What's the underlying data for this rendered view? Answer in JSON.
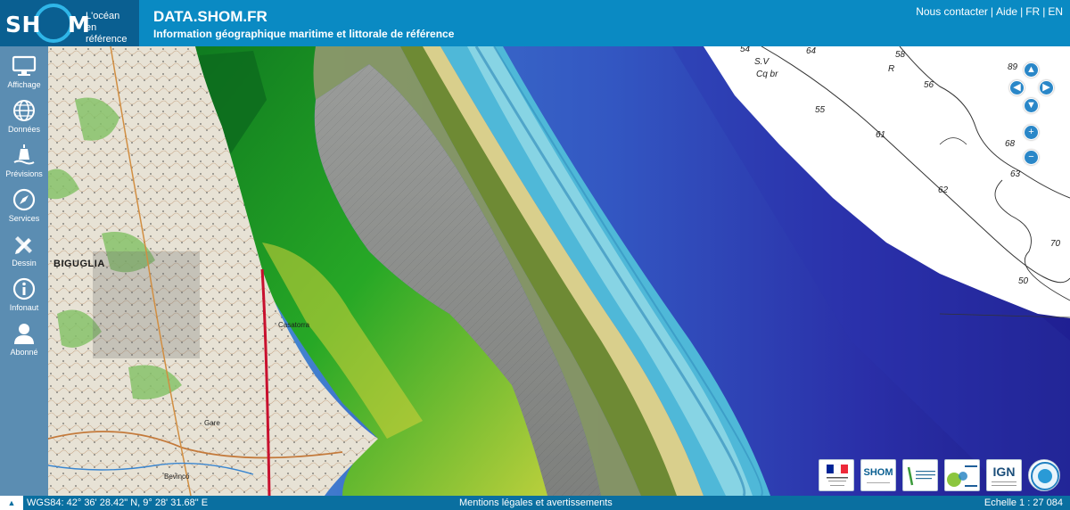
{
  "header": {
    "logo_word_left": "SH",
    "logo_word_right": "M",
    "logo_tagline_1": "L'océan",
    "logo_tagline_2": "en référence",
    "title": "DATA.SHOM.FR",
    "subtitle": "Information géographique maritime et littorale de référence",
    "links": [
      "Nous contacter",
      "Aide",
      "FR",
      "EN"
    ],
    "separator": "|"
  },
  "sidebar": {
    "items": [
      {
        "label": "Affichage",
        "icon": "monitor-icon"
      },
      {
        "label": "Données",
        "icon": "globe-icon"
      },
      {
        "label": "Prévisions",
        "icon": "buoy-icon"
      },
      {
        "label": "Services",
        "icon": "compass-icon"
      },
      {
        "label": "Dessin",
        "icon": "pencil-ruler-icon"
      },
      {
        "label": "Infonaut",
        "icon": "info-icon"
      },
      {
        "label": "Abonné",
        "icon": "user-icon"
      }
    ]
  },
  "map": {
    "town": "BIGUGLIA",
    "places": [
      "Casatorra",
      "Bevinco",
      "Gare"
    ],
    "depth_soundings": [
      "54",
      "64",
      "S.V",
      "Cq br",
      "58",
      "56",
      "89",
      "55",
      "61",
      "68",
      "63",
      "62",
      "70",
      "50",
      "R"
    ],
    "nav": {
      "up": "▲",
      "down": "▼",
      "left": "◀",
      "right": "▶",
      "zoom_in": "+",
      "zoom_out": "−"
    },
    "partners": [
      {
        "name": "Préfet de Corse",
        "icon": "marianne-logo"
      },
      {
        "name": "SHOM",
        "icon": "shom-logo"
      },
      {
        "name": "Collectivité de Corse",
        "icon": "collectivite-corse-logo"
      },
      {
        "name": "L'Europe s'engage en Corse",
        "icon": "europe-logo"
      },
      {
        "name": "IGN",
        "icon": "ign-logo"
      },
      {
        "name": "GEBCO",
        "icon": "gebco-logo"
      }
    ]
  },
  "footer": {
    "toggle": "▲",
    "coords": "WGS84: 42° 36' 28.42\" N, 9° 28' 31.68\" E",
    "mentions": "Mentions légales et avertissements",
    "scale": "Echelle 1 : 27 084"
  },
  "colors": {
    "header": "#0a8ac3",
    "logo_bg": "#0a5f91",
    "sidebar": "#5b8db2",
    "footer": "#0a6fa0",
    "deep_sea": "#1c1f9a",
    "shallow_sea": "#4fb8d8"
  }
}
